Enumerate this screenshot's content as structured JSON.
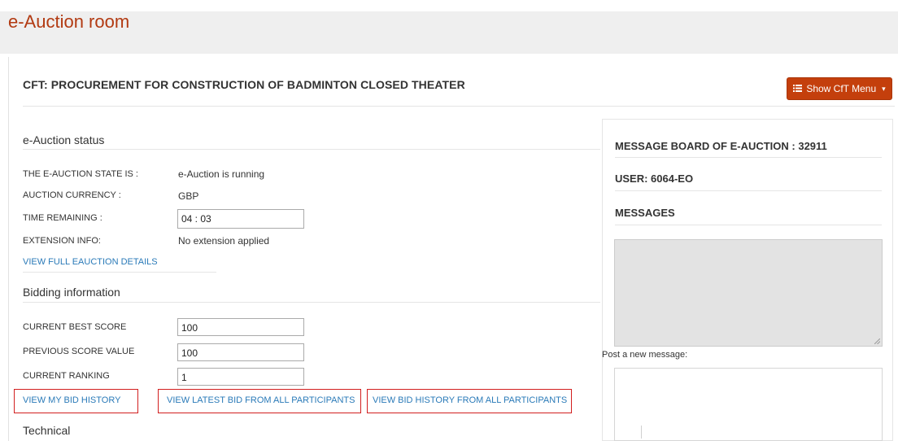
{
  "header": {
    "title": "e-Auction room"
  },
  "cft": {
    "title": "CFT: PROCUREMENT FOR CONSTRUCTION OF BADMINTON CLOSED THEATER",
    "menu_button": "Show CfT Menu",
    "menu_icon": "list-icon"
  },
  "status": {
    "section_title": "e-Auction status",
    "state_label": "THE E-AUCTION STATE IS :",
    "state_value": "e-Auction is running",
    "currency_label": "AUCTION CURRENCY :",
    "currency_value": "GBP",
    "time_label": "TIME REMAINING :",
    "time_value": "04 : 03",
    "extension_label": "EXTENSION INFO:",
    "extension_value": "No extension applied",
    "details_link": "VIEW FULL EAUCTION DETAILS"
  },
  "bidding": {
    "section_title": "Bidding information",
    "best_score_label": "CURRENT BEST SCORE",
    "best_score_value": "100",
    "prev_score_label": "PREVIOUS SCORE VALUE",
    "prev_score_value": "100",
    "ranking_label": "CURRENT RANKING",
    "ranking_value": "1",
    "links": {
      "my_history": "VIEW MY BID HISTORY",
      "latest_all": "VIEW LATEST BID FROM ALL PARTICIPANTS",
      "history_all": "VIEW BID HISTORY FROM ALL PARTICIPANTS"
    }
  },
  "technical": {
    "section_title": "Technical"
  },
  "message_board": {
    "title": "MESSAGE BOARD OF E-AUCTION : 32911",
    "user": "USER: 6064-EO",
    "messages_heading": "MESSAGES",
    "post_label": "Post a new message:"
  },
  "colors": {
    "accent": "#c43f0c",
    "title": "#b23a12",
    "link": "#2a7ab8",
    "highlight": "#d21f1f"
  }
}
